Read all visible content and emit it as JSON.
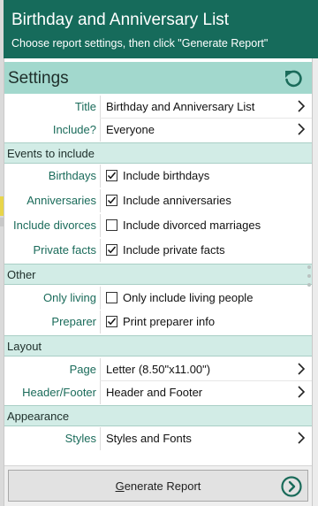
{
  "header": {
    "title": "Birthday and Anniversary List",
    "subtitle": "Choose report settings, then click \"Generate Report\""
  },
  "settings": {
    "label": "Settings",
    "title_label": "Title",
    "title_value": "Birthday and Anniversary List",
    "include_label": "Include?",
    "include_value": "Everyone"
  },
  "events": {
    "header": "Events to include",
    "birthdays_label": "Birthdays",
    "birthdays_text": "Include birthdays",
    "birthdays_checked": true,
    "anniversaries_label": "Anniversaries",
    "anniversaries_text": "Include anniversaries",
    "anniversaries_checked": true,
    "divorces_label": "Include divorces",
    "divorces_text": "Include divorced marriages",
    "divorces_checked": false,
    "private_label": "Private facts",
    "private_text": "Include private facts",
    "private_checked": true
  },
  "other": {
    "header": "Other",
    "living_label": "Only living",
    "living_text": "Only include living people",
    "living_checked": false,
    "preparer_label": "Preparer",
    "preparer_text": "Print preparer info",
    "preparer_checked": true
  },
  "layout": {
    "header": "Layout",
    "page_label": "Page",
    "page_value": "Letter (8.50\"x11.00\")",
    "hf_label": "Header/Footer",
    "hf_value": "Header and Footer"
  },
  "appearance": {
    "header": "Appearance",
    "styles_label": "Styles",
    "styles_value": "Styles and Fonts"
  },
  "footer": {
    "generate_access_key": "G",
    "generate_rest": "enerate Report"
  },
  "colors": {
    "header_bg": "#166b5b",
    "settings_bar": "#a2d8cd",
    "section_bg": "#d2ece6",
    "label_green": "#1a6b5a"
  },
  "icons": {
    "refresh": "refresh-icon",
    "chevron": "chevron-right-icon",
    "checkmark": "checkmark-icon",
    "generate": "circle-arrow-right-icon"
  }
}
